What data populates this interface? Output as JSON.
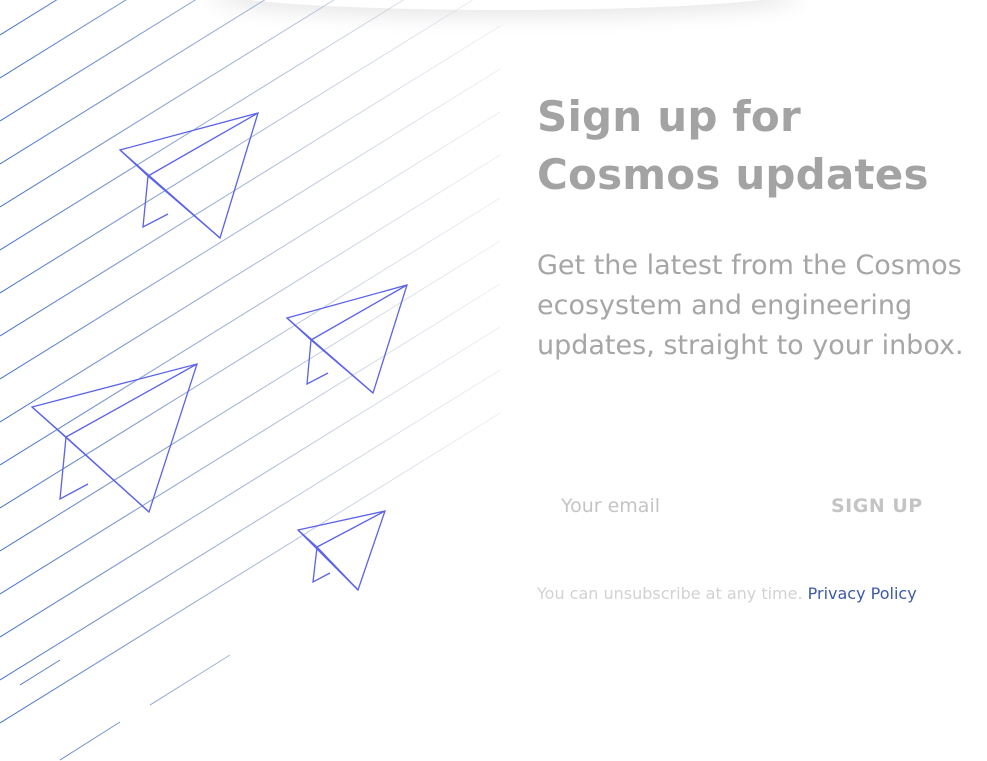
{
  "signup": {
    "heading_line1": "Sign up for",
    "heading_line2": "Cosmos updates",
    "description": "Get the latest from the Cosmos ecosystem and engineering updates, straight to your inbox.",
    "email_placeholder": "Your email",
    "email_value": "",
    "button_label": "SIGN UP",
    "unsubscribe_text": "You can unsubscribe at any time.",
    "privacy_link_label": "Privacy Policy"
  },
  "illustration": {
    "icon": "paper-plane-icon",
    "plane_count": 4
  },
  "colors": {
    "heading": "#a3a3a3",
    "body_text": "#a6a6a6",
    "muted": "#c4c4c4",
    "link": "#3e5aa8",
    "plane_stroke": "#5b63e8",
    "line_stroke": "#3f6fc6"
  }
}
